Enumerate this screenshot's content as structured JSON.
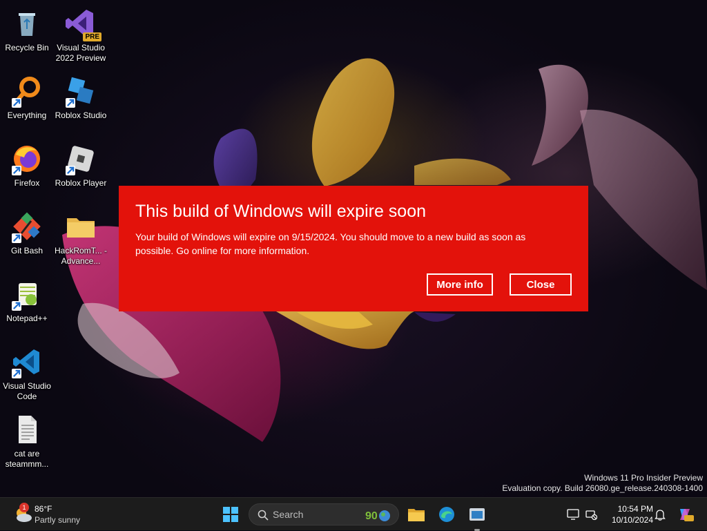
{
  "desktop": {
    "icons": [
      {
        "label": "Recycle Bin",
        "icon": "recycle-bin-icon"
      },
      {
        "label": "Visual Studio 2022 Preview",
        "icon": "visual-studio-icon",
        "badge": "PRE"
      },
      {
        "label": "Everything",
        "icon": "everything-search-icon"
      },
      {
        "label": "Roblox Studio",
        "icon": "roblox-studio-icon"
      },
      {
        "label": "Firefox",
        "icon": "firefox-icon"
      },
      {
        "label": "Roblox Player",
        "icon": "roblox-player-icon"
      },
      {
        "label": "Git Bash",
        "icon": "git-bash-icon"
      },
      {
        "label": "HackRomT... - Advance...",
        "icon": "folder-icon"
      },
      {
        "label": "Notepad++",
        "icon": "notepad-plus-plus-icon"
      },
      {
        "label": "Visual Studio Code",
        "icon": "vscode-icon"
      },
      {
        "label": "cat are steammm...",
        "icon": "text-file-icon"
      }
    ]
  },
  "dialog": {
    "title": "This build of Windows will expire soon",
    "body": "Your build of Windows will expire on 9/15/2024. You should move to a new build as soon as possible. Go online for more information.",
    "more_info_label": "More info",
    "close_label": "Close",
    "background_color": "#e3120b"
  },
  "watermark": {
    "line1": "Windows 11 Pro Insider Preview",
    "line2": "Evaluation copy. Build 26080.ge_release.240308-1400"
  },
  "taskbar": {
    "weather": {
      "badge": "1",
      "temp": "86°F",
      "condition": "Partly sunny"
    },
    "search_placeholder": "Search",
    "pinned": [
      "start-icon",
      "file-explorer-icon",
      "edge-icon",
      "app-window-icon"
    ],
    "clock": {
      "time": "10:54 PM",
      "date": "10/10/2024"
    },
    "tray_icons": [
      "display-icon",
      "network-icon",
      "notification-bell-icon",
      "copilot-icon"
    ]
  }
}
